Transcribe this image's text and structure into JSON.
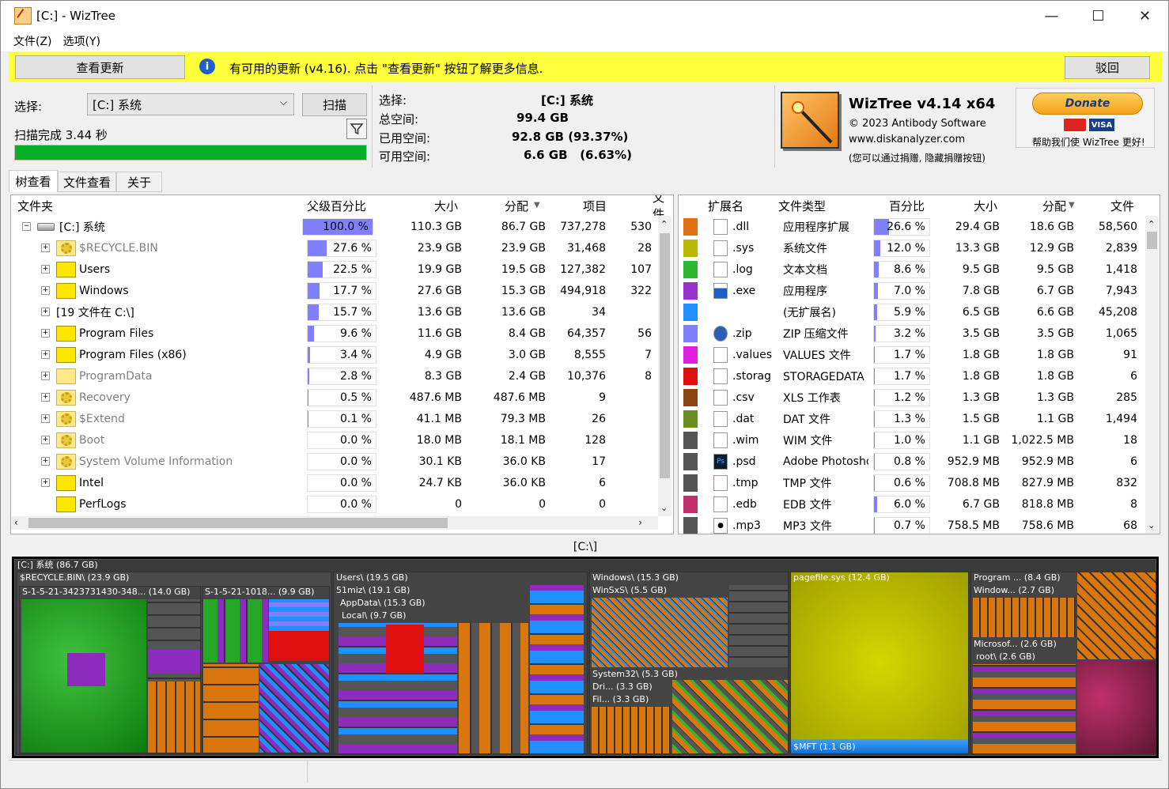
{
  "window": {
    "title": "[C:]  - WizTree",
    "controls": [
      "—",
      "☐",
      "✕"
    ]
  },
  "menu": [
    "文件(Z)",
    "选项(Y)"
  ],
  "update_bar": {
    "check_button": "查看更新",
    "message": "有可用的更新 (v4.16). 点击 \"查看更新\" 按钮了解更多信息.",
    "dismiss_button": "驳回"
  },
  "scan": {
    "select_label": "选择:",
    "drive_value": "[C:] 系统",
    "scan_button": "扫描",
    "status": "扫描完成 3.44 秒",
    "progress_pct": 100
  },
  "drive_info": {
    "select_label": "选择:",
    "select_value": "[C:]  系统",
    "total_label": "总空间:",
    "total_value": "99.4 GB",
    "used_label": "已用空间:",
    "used_value": "92.8 GB  (93.37%)",
    "free_label": "可用空间:",
    "free_value": "6.6 GB   (6.63%)"
  },
  "about": {
    "product": "WizTree v4.14 x64",
    "copyright": "© 2023 Antibody Software",
    "site": "www.diskanalyzer.com",
    "note": "(您可以通过捐赠, 隐藏捐赠按钮)",
    "donate_label": "Donate",
    "help_text": "帮助我们使 WizTree 更好!"
  },
  "tabs": [
    "树查看",
    "文件查看",
    "关于"
  ],
  "tree": {
    "headers": [
      "文件夹",
      "父级百分比",
      "大小",
      "分配",
      "项目",
      "文件"
    ],
    "rows": [
      {
        "name": "[C:] 系统",
        "type": "drive",
        "pct": "100.0 %",
        "pct_val": 100,
        "size": "110.3 GB",
        "alloc": "86.7 GB",
        "items": "737,278",
        "files": "530"
      },
      {
        "name": "$RECYCLE.BIN",
        "type": "sys",
        "pct": "27.6 %",
        "pct_val": 27.6,
        "size": "23.9 GB",
        "alloc": "23.9 GB",
        "items": "31,468",
        "files": "28"
      },
      {
        "name": "Users",
        "type": "folder",
        "pct": "22.5 %",
        "pct_val": 22.5,
        "size": "19.9 GB",
        "alloc": "19.5 GB",
        "items": "127,382",
        "files": "107"
      },
      {
        "name": "Windows",
        "type": "folder",
        "pct": "17.7 %",
        "pct_val": 17.7,
        "size": "27.6 GB",
        "alloc": "15.3 GB",
        "items": "494,918",
        "files": "322"
      },
      {
        "name": "[19 文件在 C:\\]",
        "type": "files",
        "pct": "15.7 %",
        "pct_val": 15.7,
        "size": "13.6 GB",
        "alloc": "13.6 GB",
        "items": "34",
        "files": ""
      },
      {
        "name": "Program Files",
        "type": "folder",
        "pct": "9.6 %",
        "pct_val": 9.6,
        "size": "11.6 GB",
        "alloc": "8.4 GB",
        "items": "64,357",
        "files": "56"
      },
      {
        "name": "Program Files (x86)",
        "type": "folder",
        "pct": "3.4 %",
        "pct_val": 3.4,
        "size": "4.9 GB",
        "alloc": "3.0 GB",
        "items": "8,555",
        "files": "7"
      },
      {
        "name": "ProgramData",
        "type": "gray",
        "pct": "2.8 %",
        "pct_val": 2.8,
        "size": "8.3 GB",
        "alloc": "2.4 GB",
        "items": "10,376",
        "files": "8"
      },
      {
        "name": "Recovery",
        "type": "sys",
        "pct": "0.5 %",
        "pct_val": 0.5,
        "size": "487.6 MB",
        "alloc": "487.6 MB",
        "items": "9",
        "files": ""
      },
      {
        "name": "$Extend",
        "type": "sys",
        "pct": "0.1 %",
        "pct_val": 0.1,
        "size": "41.1 MB",
        "alloc": "79.3 MB",
        "items": "26",
        "files": ""
      },
      {
        "name": "Boot",
        "type": "sys",
        "pct": "0.0 %",
        "pct_val": 0,
        "size": "18.0 MB",
        "alloc": "18.1 MB",
        "items": "128",
        "files": ""
      },
      {
        "name": "System Volume Information",
        "type": "sys",
        "pct": "0.0 %",
        "pct_val": 0,
        "size": "30.1 KB",
        "alloc": "36.0 KB",
        "items": "17",
        "files": ""
      },
      {
        "name": "Intel",
        "type": "folder",
        "pct": "0.0 %",
        "pct_val": 0,
        "size": "24.7 KB",
        "alloc": "36.0 KB",
        "items": "6",
        "files": ""
      },
      {
        "name": "PerfLogs",
        "type": "folder",
        "pct": "0.0 %",
        "pct_val": 0,
        "size": "0",
        "alloc": "0",
        "items": "0",
        "files": ""
      }
    ]
  },
  "ext": {
    "headers": [
      "扩展名",
      "文件类型",
      "百分比",
      "大小",
      "分配",
      "文件"
    ],
    "rows": [
      {
        "color": "#e07010",
        "ext": ".dll",
        "type": "应用程序扩展",
        "pct": "26.6 %",
        "pct_val": 26.6,
        "size": "29.4 GB",
        "alloc": "18.6 GB",
        "files": "58,560"
      },
      {
        "color": "#b8b800",
        "ext": ".sys",
        "type": "系统文件",
        "pct": "12.0 %",
        "pct_val": 12.0,
        "size": "13.3 GB",
        "alloc": "12.9 GB",
        "files": "2,839"
      },
      {
        "color": "#2db82d",
        "ext": ".log",
        "type": "文本文档",
        "pct": "8.6 %",
        "pct_val": 8.6,
        "size": "9.5 GB",
        "alloc": "9.5 GB",
        "files": "1,418"
      },
      {
        "color": "#9932cc",
        "ext": ".exe",
        "type": "应用程序",
        "pct": "7.0 %",
        "pct_val": 7.0,
        "size": "7.8 GB",
        "alloc": "6.7 GB",
        "files": "7,943"
      },
      {
        "color": "#1e90ff",
        "ext": "",
        "type": "(无扩展名)",
        "pct": "5.9 %",
        "pct_val": 5.9,
        "size": "6.5 GB",
        "alloc": "6.6 GB",
        "files": "45,208"
      },
      {
        "color": "#8080ff",
        "ext": ".zip",
        "type": "ZIP 压缩文件",
        "pct": "3.2 %",
        "pct_val": 3.2,
        "size": "3.5 GB",
        "alloc": "3.5 GB",
        "files": "1,065"
      },
      {
        "color": "#e020e0",
        "ext": ".values",
        "type": "VALUES 文件",
        "pct": "1.7 %",
        "pct_val": 1.7,
        "size": "1.8 GB",
        "alloc": "1.8 GB",
        "files": "91"
      },
      {
        "color": "#e01010",
        "ext": ".storag",
        "type": "STORAGEDATA 文",
        "pct": "1.7 %",
        "pct_val": 1.7,
        "size": "1.8 GB",
        "alloc": "1.8 GB",
        "files": "6"
      },
      {
        "color": "#8b4513",
        "ext": ".csv",
        "type": "XLS 工作表",
        "pct": "1.2 %",
        "pct_val": 1.2,
        "size": "1.3 GB",
        "alloc": "1.3 GB",
        "files": "285"
      },
      {
        "color": "#6b8e23",
        "ext": ".dat",
        "type": "DAT 文件",
        "pct": "1.3 %",
        "pct_val": 1.3,
        "size": "1.5 GB",
        "alloc": "1.1 GB",
        "files": "1,494"
      },
      {
        "color": "#555555",
        "ext": ".wim",
        "type": "WIM 文件",
        "pct": "1.0 %",
        "pct_val": 1.0,
        "size": "1.1 GB",
        "alloc": "1,022.5 MB",
        "files": "18"
      },
      {
        "color": "#555555",
        "ext": ".psd",
        "type": "Adobe Photoshc",
        "pct": "0.8 %",
        "pct_val": 0.8,
        "size": "952.9 MB",
        "alloc": "952.9 MB",
        "files": "6"
      },
      {
        "color": "#555555",
        "ext": ".tmp",
        "type": "TMP 文件",
        "pct": "0.6 %",
        "pct_val": 0.6,
        "size": "708.8 MB",
        "alloc": "827.9 MB",
        "files": "832"
      },
      {
        "color": "#c0306a",
        "ext": ".edb",
        "type": "EDB 文件",
        "pct": "6.0 %",
        "pct_val": 6.0,
        "size": "6.7 GB",
        "alloc": "818.8 MB",
        "files": "8"
      },
      {
        "color": "#555555",
        "ext": ".mp3",
        "type": "MP3 文件",
        "pct": "0.7 %",
        "pct_val": 0.7,
        "size": "758.5 MB",
        "alloc": "758.6 MB",
        "files": "68"
      }
    ]
  },
  "path_label": "[C:\\]",
  "treemap": {
    "root": "[C:] 系统  (86.7 GB)",
    "labels": {
      "recycle": "$RECYCLE.BIN\\ (23.9 GB)",
      "s1": "S-1-5-21-3423731430-348... (14.0 GB)",
      "s2": "S-1-5-21-1018... (9.9 GB)",
      "users": "Users\\ (19.5 GB)",
      "miz": "51miz\\ (19.1 GB)",
      "appdata": "AppData\\ (15.3 GB)",
      "local": "Local\\ (9.7 GB)",
      "windows": "Windows\\ (15.3 GB)",
      "winsxs": "WinSxS\\ (5.5 GB)",
      "system32": "System32\\ (5.3 GB)",
      "dri": "Dri... (3.3 GB)",
      "fil": "Fil... (3.3 GB)",
      "pagefile": "pagefile.sys (12.4 GB)",
      "mft": "$MFT (1.1 GB)",
      "program": "Program ... (8.4 GB)",
      "window2": "Window... (2.7 GB)",
      "microsof": "Microsof... (2.6 GB)",
      "root": "root\\ (2.6 GB)"
    }
  }
}
